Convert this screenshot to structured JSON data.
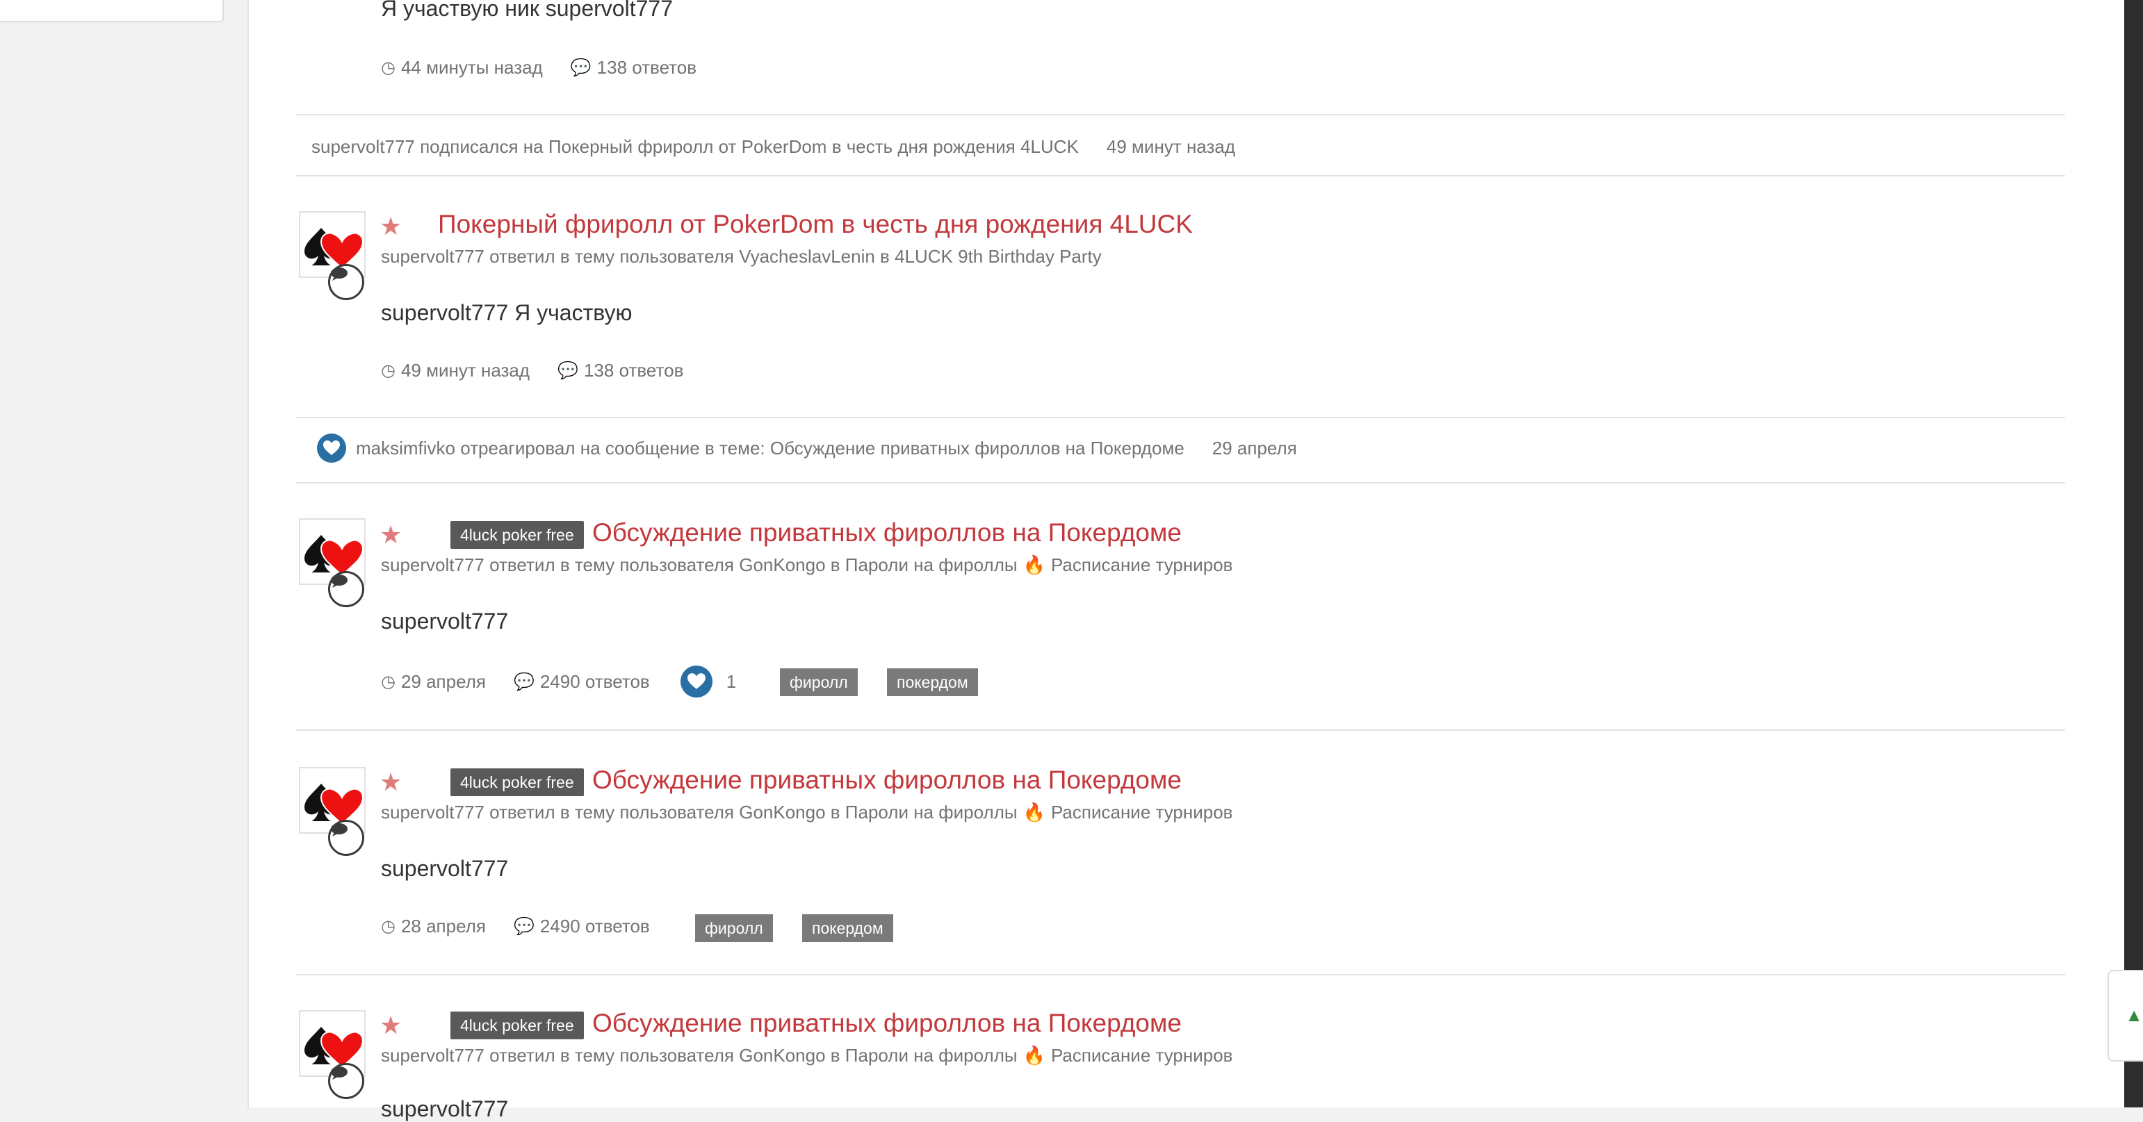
{
  "items": [
    {
      "type": "post_tail",
      "body": "Я участвую ник supervolt777",
      "time": "44 минуты назад",
      "replies": "138 ответов"
    },
    {
      "type": "activity",
      "text": "supervolt777 подписался на Покерный фриролл от PokerDom в честь дня рождения 4LUCK",
      "time": "49 минут назад"
    },
    {
      "type": "post",
      "title": "Покерный фриролл от PokerDom в честь дня рождения 4LUCK",
      "subline": "supervolt777 ответил в тему пользователя VyacheslavLenin в 4LUCK 9th Birthday Party",
      "body": "supervolt777 Я участвую",
      "time": "49 минут назад",
      "replies": "138 ответов"
    },
    {
      "type": "activity",
      "text": "maksimfivko отреагировал на сообщение в теме: Обсуждение приватных фироллов на Покердоме",
      "time": "29 апреля"
    },
    {
      "type": "post",
      "badge": "4luck poker free",
      "title": "Обсуждение приватных фироллов на Покердоме",
      "subline_a": "supervolt777 ответил в тему пользователя GonKongo в Пароли на фироллы",
      "subline_b": "Расписание турниров",
      "body": "supervolt777",
      "time": "29 апреля",
      "replies": "2490 ответов",
      "reactions": "1",
      "tags": [
        "фиролл",
        "покердом"
      ]
    },
    {
      "type": "post",
      "badge": "4luck poker free",
      "title": "Обсуждение приватных фироллов на Покердоме",
      "subline_a": "supervolt777 ответил в тему пользователя GonKongo в Пароли на фироллы",
      "subline_b": "Расписание турниров",
      "body": "supervolt777",
      "time": "28 апреля",
      "replies": "2490 ответов",
      "tags": [
        "фиролл",
        "покердом"
      ]
    },
    {
      "type": "post",
      "badge": "4luck poker free",
      "title": "Обсуждение приватных фироллов на Покердоме",
      "subline_a": "supervolt777 ответил в тему пользователя GonKongo в Пароли на фироллы",
      "subline_b": "Расписание турниров",
      "body": "supervolt777"
    }
  ],
  "colors": {
    "title": "#c3383c",
    "star": "#e07b7b",
    "badge": "#595959",
    "tag": "#7a7a7a",
    "reaction": "#2a6fa4"
  },
  "icons": [
    "clock-icon",
    "comment-icon",
    "star-icon",
    "heart-icon",
    "fire-icon",
    "chat-bubble-icon",
    "poker-avatar-icon"
  ]
}
